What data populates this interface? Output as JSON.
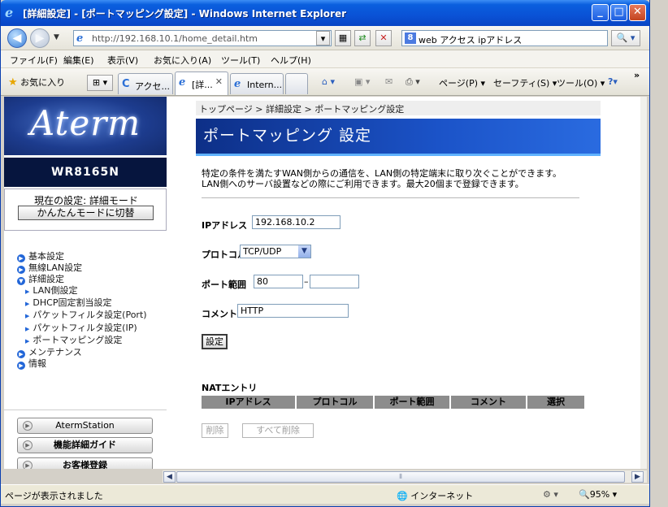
{
  "window": {
    "title": "[詳細設定] - [ポートマッピング設定] - Windows Internet Explorer",
    "minimize": "_",
    "maximize": "□",
    "close": "✕"
  },
  "addressbar": {
    "back": "◀",
    "forward": "▶",
    "dropdown": "▼",
    "url": "http://192.168.10.1/home_detail.htm",
    "search_text": "web アクセス ipアドレス",
    "search_go": "🔍 ▾"
  },
  "menubar": [
    "ファイル(F)",
    "編集(E)",
    "表示(V)",
    "お気に入り(A)",
    "ツール(T)",
    "ヘルプ(H)"
  ],
  "tabbar": {
    "favorites": "お気に入り",
    "tabs": [
      {
        "label": "アクセ..."
      },
      {
        "label": "[詳...",
        "close": "✕"
      },
      {
        "label": "Intern..."
      }
    ],
    "tools": {
      "page": "ページ(P)",
      "safety": "セーフティ(S)",
      "tools": "ツール(O)",
      "more": "»"
    }
  },
  "sidebar": {
    "brand": "Aterm",
    "model": "WR8165N",
    "current_mode": "現在の設定: 詳細モード",
    "switch_button": "かんたんモードに切替",
    "menu": [
      {
        "label": "基本設定"
      },
      {
        "label": "無線LAN設定"
      },
      {
        "label": "詳細設定"
      }
    ],
    "submenu": [
      {
        "label": "LAN側設定"
      },
      {
        "label": "DHCP固定割当設定"
      },
      {
        "label": "パケットフィルタ設定(Port)"
      },
      {
        "label": "パケットフィルタ設定(IP)"
      },
      {
        "label": "ポートマッピング設定"
      }
    ],
    "menu_after": [
      {
        "label": "メンテナンス"
      },
      {
        "label": "情報"
      }
    ],
    "buttons": [
      "AtermStation",
      "機能詳細ガイド",
      "お客様登録"
    ]
  },
  "main": {
    "breadcrumb": "トップページ > 詳細設定 > ポートマッピング設定",
    "title": "ポートマッピング 設定",
    "description_1": "特定の条件を満たすWAN側からの通信を、LAN側の特定端末に取り次ぐことができます。",
    "description_2": "LAN側へのサーバ設置などの際にご利用できます。最大20個まで登録できます。",
    "form": {
      "ip_label": "IPアドレス",
      "ip_value": "192.168.10.2",
      "protocol_label": "プロトコル",
      "protocol_value": "TCP/UDP",
      "port_label": "ポート範囲",
      "port_from": "80",
      "port_sep": "–",
      "port_to": "",
      "comment_label": "コメント",
      "comment_value": "HTTP",
      "set_button": "設定"
    },
    "nat": {
      "title": "NATエントリ",
      "columns": [
        "IPアドレス",
        "プロトコル",
        "ポート範囲",
        "コメント",
        "選択"
      ],
      "delete_button": "削除",
      "delete_all_button": "すべて削除"
    }
  },
  "statusbar": {
    "text": "ページが表示されました",
    "zone": "インターネット",
    "zoom": "95%"
  }
}
